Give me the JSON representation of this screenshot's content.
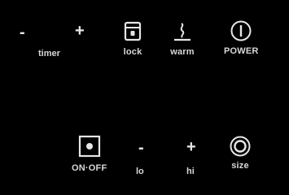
{
  "panel": {
    "timer": {
      "minus": "-",
      "plus": "+",
      "label": "timer"
    },
    "lock": {
      "label": "lock",
      "icon": "lock-icon"
    },
    "warm": {
      "label": "warm",
      "icon": "warm-icon"
    },
    "power": {
      "label": "POWER",
      "icon": "power-icon"
    },
    "on_off": {
      "label": "ON·OFF",
      "icon": "on-off-icon"
    },
    "lo": {
      "symbol": "-",
      "label": "lo"
    },
    "hi": {
      "symbol": "+",
      "label": "hi"
    },
    "size": {
      "label": "size",
      "icon": "size-icon"
    }
  },
  "colors": {
    "background": "#000000",
    "foreground": "#e0e0e0"
  }
}
